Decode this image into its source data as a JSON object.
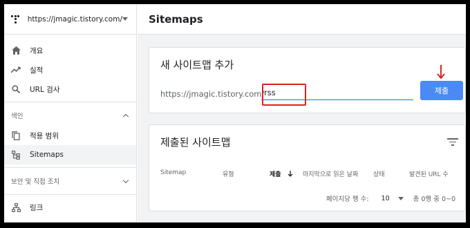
{
  "property": {
    "url": "https://jmagic.tistory.com/"
  },
  "sidebar": {
    "items_top": [
      {
        "label": "개요",
        "icon": "home-icon"
      },
      {
        "label": "실적",
        "icon": "trend-icon"
      },
      {
        "label": "URL 검사",
        "icon": "search-icon"
      }
    ],
    "section_index": "색인",
    "items_index": [
      {
        "label": "적용 범위",
        "icon": "copy-icon"
      },
      {
        "label": "Sitemaps",
        "icon": "sitemap-icon",
        "active": true
      }
    ],
    "section_security": "보안 및 직접 조치",
    "items_links": [
      {
        "label": "링크",
        "icon": "links-icon"
      }
    ]
  },
  "header": {
    "title": "Sitemaps"
  },
  "add_sitemap": {
    "title": "새 사이트맵 추가",
    "url_prefix": "https://jmagic.tistory.com/",
    "input_value": "rss",
    "submit_label": "제출"
  },
  "submitted": {
    "title": "제출된 사이트맵",
    "columns": [
      "Sitemap",
      "유형",
      "제출",
      "마지막으로 읽은 날짜",
      "상태",
      "발견된 URL 수"
    ],
    "rows_per_page_label": "페이지당 행 수:",
    "rows_per_page": "10",
    "range_text": "총 0행 중 0~0"
  },
  "colors": {
    "accent": "#1a73e8",
    "button": "#4a8af4",
    "annotation": "#e02020"
  }
}
